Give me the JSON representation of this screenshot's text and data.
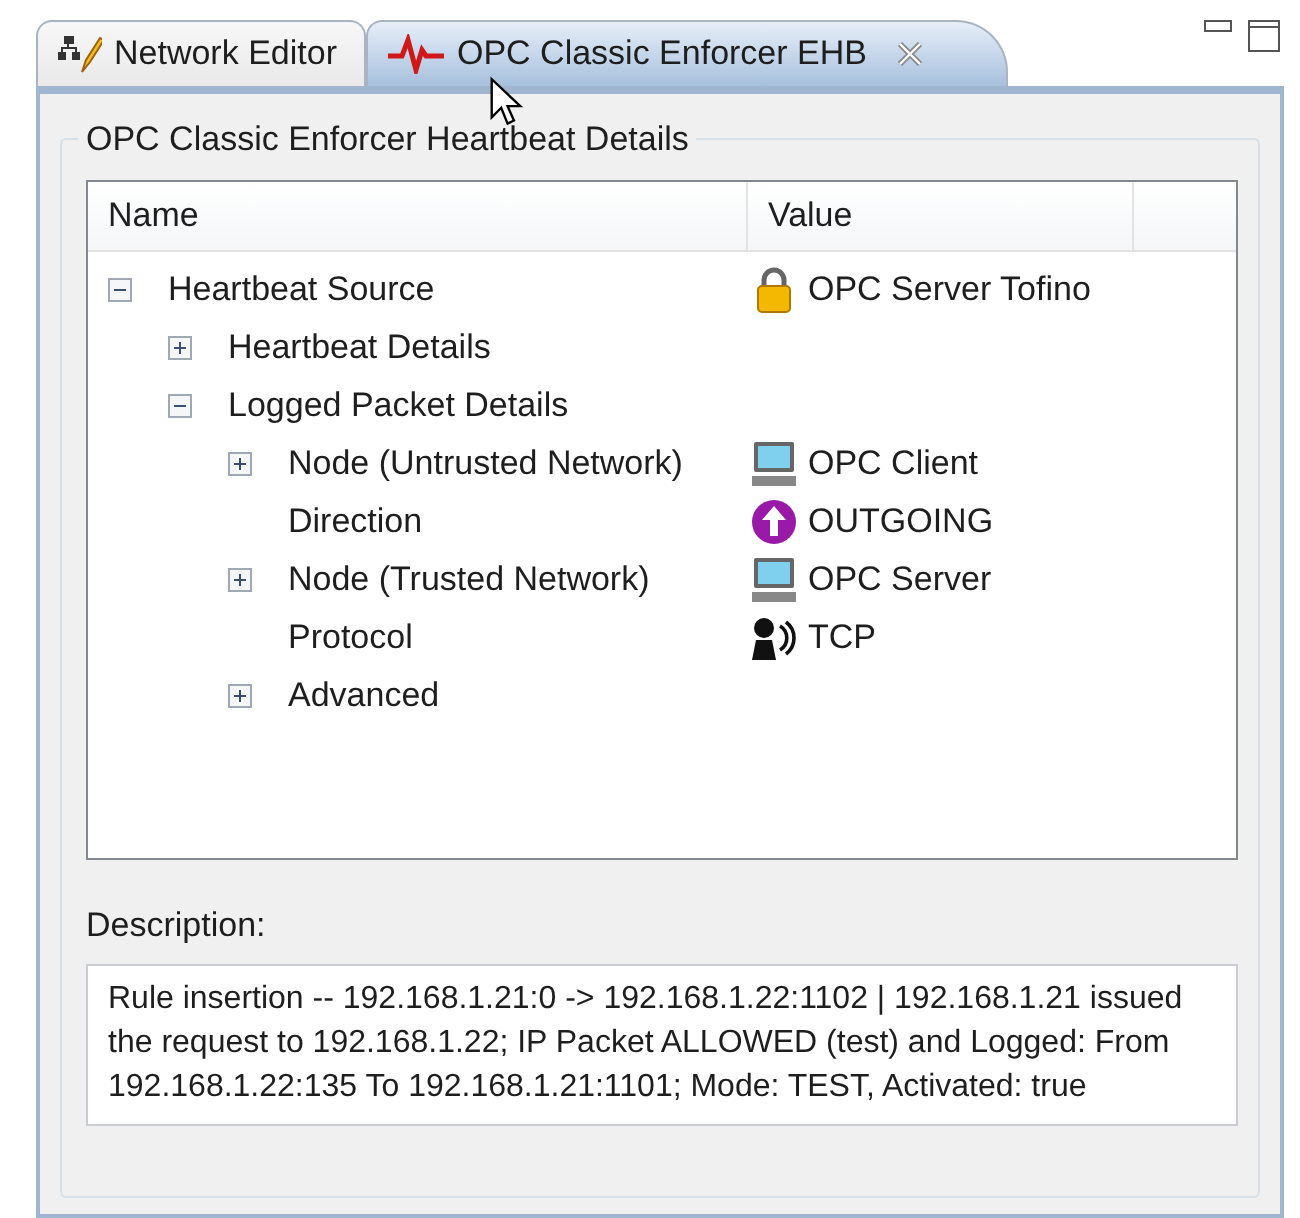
{
  "tabs": [
    {
      "label": "Network Editor",
      "selected": false,
      "kind": "network",
      "closable": false
    },
    {
      "label": "OPC Classic Enforcer EHB",
      "selected": true,
      "kind": "heartbeat",
      "closable": true
    }
  ],
  "group": {
    "title": "OPC Classic Enforcer Heartbeat Details"
  },
  "tree": {
    "columns": [
      "Name",
      "Value"
    ],
    "rows": [
      {
        "name": "Heartbeat Source",
        "expanded": true,
        "value": {
          "text": "OPC Server Tofino",
          "kind": "lock"
        },
        "children": [
          {
            "name": "Heartbeat Details",
            "expanded": false
          },
          {
            "name": "Logged Packet Details",
            "expanded": true,
            "children": [
              {
                "name": "Node (Untrusted Network)",
                "expanded": false,
                "value": {
                  "text": "OPC Client",
                  "kind": "computer"
                }
              },
              {
                "name": "Direction",
                "value": {
                  "text": "OUTGOING",
                  "kind": "direction"
                }
              },
              {
                "name": "Node (Trusted Network)",
                "expanded": false,
                "value": {
                  "text": "OPC Server",
                  "kind": "computer"
                }
              },
              {
                "name": "Protocol",
                "value": {
                  "text": "TCP",
                  "kind": "protocol"
                }
              },
              {
                "name": "Advanced",
                "expanded": false
              }
            ]
          }
        ]
      }
    ]
  },
  "description": {
    "label": "Description:",
    "text": "Rule insertion -- 192.168.1.21:0 -> 192.168.1.22:1102 | 192.168.1.21 issued the request to 192.168.1.22; IP Packet ALLOWED (test) and Logged: From 192.168.1.22:135 To 192.168.1.21:1101; Mode: TEST, Activated: true"
  }
}
